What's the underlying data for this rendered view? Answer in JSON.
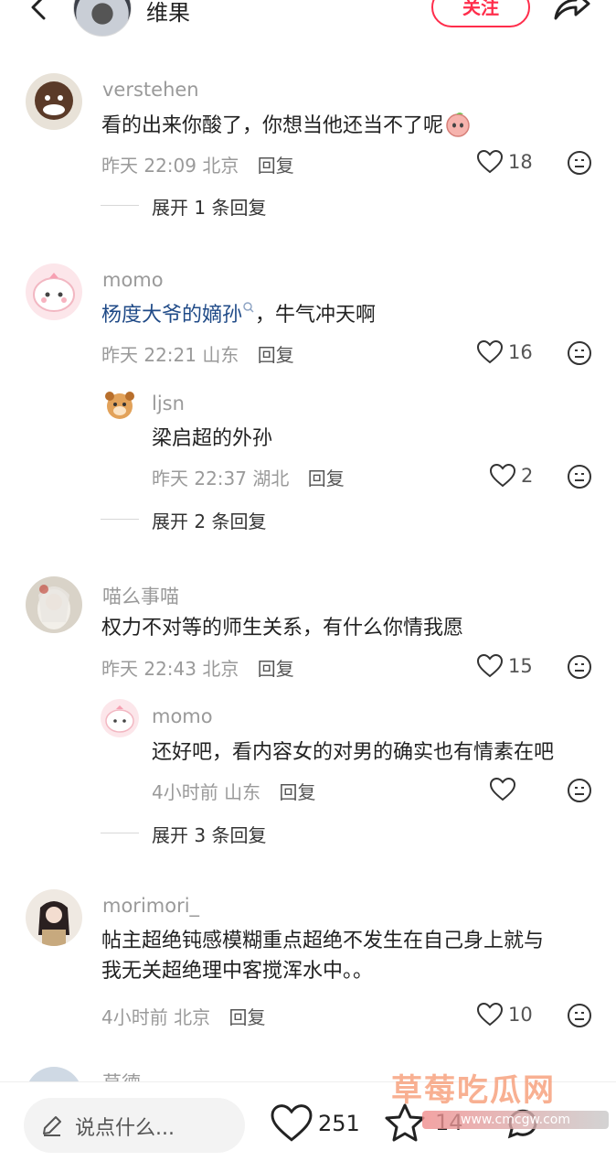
{
  "header": {
    "author_name": "维果",
    "follow_label": "关注"
  },
  "comments": [
    {
      "username": "verstehen",
      "text": "看的出来你酸了，你想当他还当不了呢",
      "time": "昨天 22:09",
      "location": "北京",
      "reply_label": "回复",
      "likes": "18",
      "expand": "展开 1 条回复"
    },
    {
      "username": "momo",
      "text_link": "杨度大爷的嫡孙",
      "text_rest": "，牛气冲天啊",
      "time": "昨天 22:21",
      "location": "山东",
      "reply_label": "回复",
      "likes": "16",
      "reply": {
        "username": "ljsn",
        "text": "梁启超的外孙",
        "time": "昨天 22:37",
        "location": "湖北",
        "reply_label": "回复",
        "likes": "2"
      },
      "expand": "展开 2 条回复"
    },
    {
      "username": "喵么事喵",
      "text": "权力不对等的师生关系，有什么你情我愿",
      "time": "昨天 22:43",
      "location": "北京",
      "reply_label": "回复",
      "likes": "15",
      "reply": {
        "username": "momo",
        "text": "还好吧，看内容女的对男的确实也有情素在吧",
        "time": "4小时前",
        "location": "山东",
        "reply_label": "回复",
        "likes": ""
      },
      "expand": "展开 3 条回复"
    },
    {
      "username": "morimori_",
      "text_line1": "帖主超绝钝感模糊重点超绝不发生在自己身上就与",
      "text_line2": "我无关超绝理中客搅浑水中。。",
      "time": "4小时前",
      "location": "北京",
      "reply_label": "回复",
      "likes": "10"
    },
    {
      "username": "草德"
    }
  ],
  "bottom_bar": {
    "input_placeholder": "说点什么...",
    "likes": "251",
    "stars": "14"
  },
  "watermark": {
    "text": "草莓吃瓜网",
    "sub": "www.cmcgw.com"
  },
  "colors": {
    "accent": "#ff2d4b",
    "link": "#1f4a87",
    "muted": "#9a9a9a"
  }
}
